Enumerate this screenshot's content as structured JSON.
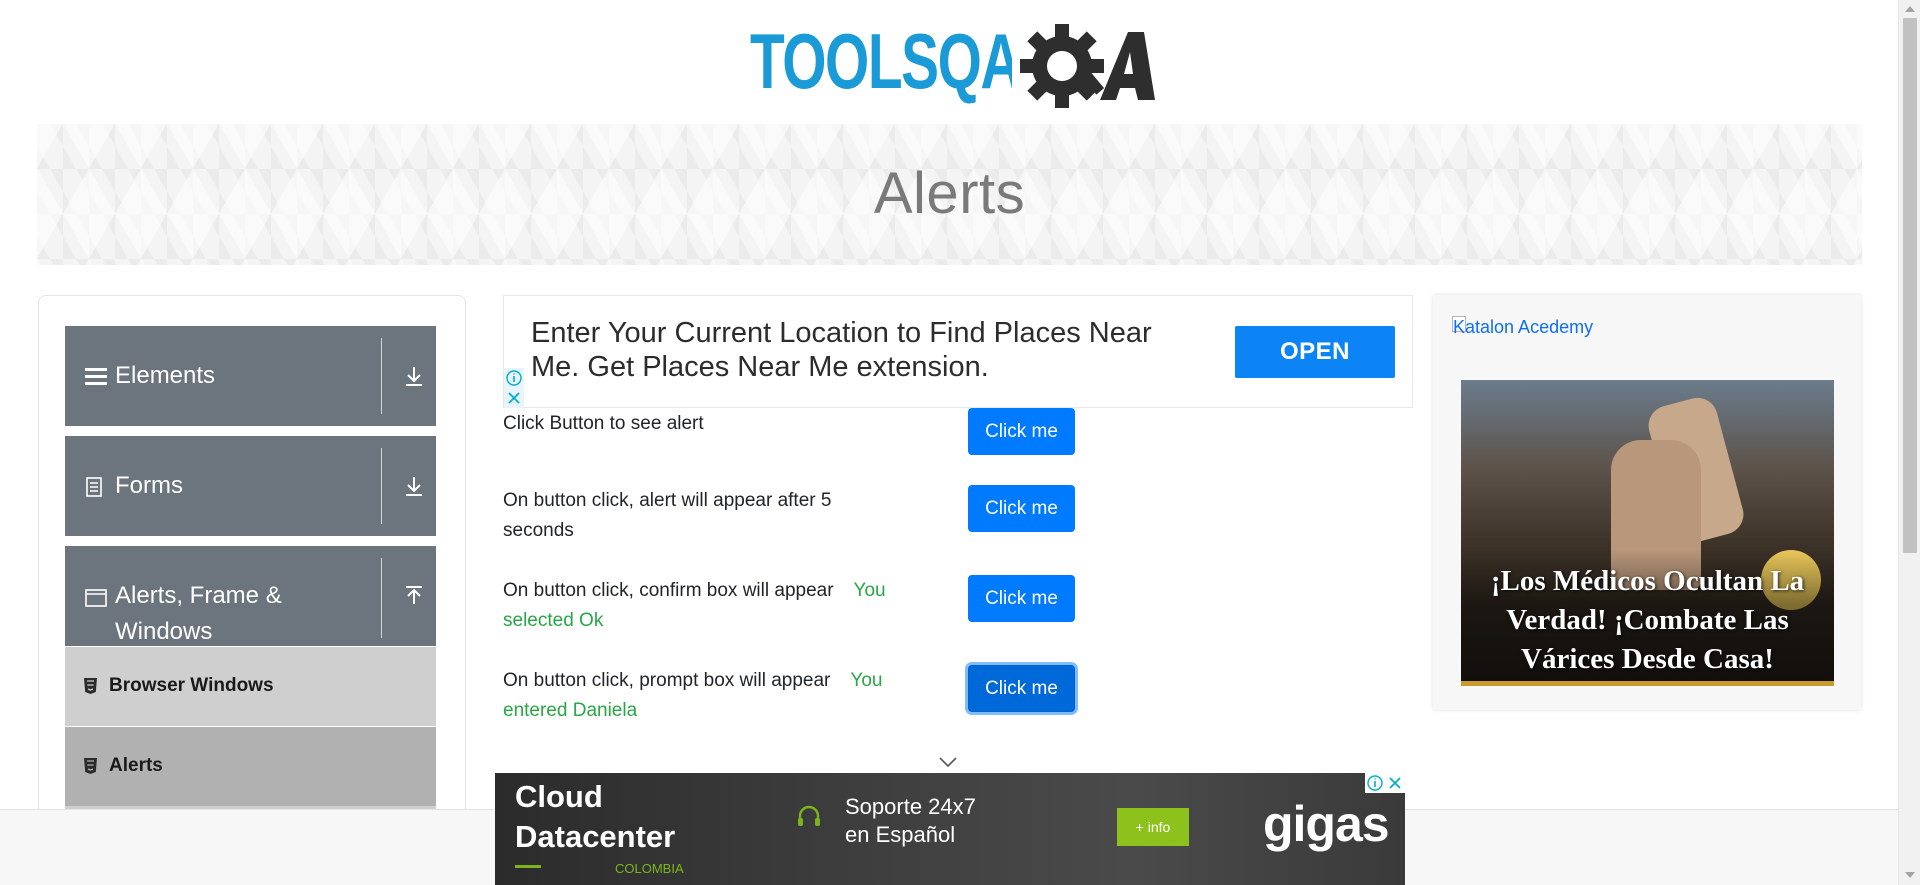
{
  "header": {
    "logo_text": "TOOLSQA",
    "colors": {
      "logo_blue": "#1a9bd7",
      "logo_dark": "#2e2e2e"
    }
  },
  "banner": {
    "title": "Alerts"
  },
  "sidebar": {
    "groups": [
      {
        "label": "Elements",
        "icon": "hamburger-icon",
        "arrow": "download-arrow-icon"
      },
      {
        "label": "Forms",
        "icon": "form-document-icon",
        "arrow": "download-arrow-icon"
      },
      {
        "label": "Alerts, Frame & Windows",
        "label_line1": "Alerts, Frame &",
        "label_line2": "Windows",
        "icon": "window-icon",
        "arrow": "upload-arrow-icon"
      }
    ],
    "items": [
      {
        "label": "Browser Windows",
        "icon": "html5-icon",
        "active": false
      },
      {
        "label": "Alerts",
        "icon": "html5-icon",
        "active": true
      }
    ],
    "colors": {
      "group_bg": "#6c757d",
      "item_bg": "#cfcfcf",
      "item_active_bg": "#b1b1b1"
    }
  },
  "ad_top": {
    "text": "Enter Your Current Location to Find Places Near Me. Get Places Near Me extension.",
    "button": "OPEN"
  },
  "alerts": [
    {
      "label": "Click Button to see alert",
      "result": "",
      "button": "Click me"
    },
    {
      "label": "On button click, alert will appear after 5 seconds",
      "label_line1": "On button click, alert will appear after 5",
      "label_line2": "seconds",
      "result": "",
      "button": "Click me"
    },
    {
      "label": "On button click, confirm box will appear",
      "result": "You selected Ok",
      "result_line1": "You",
      "result_line2": "selected Ok",
      "button": "Click me"
    },
    {
      "label": "On button click, prompt box will appear",
      "result": "You entered Daniela",
      "result_line1": "You",
      "result_line2": "entered Daniela",
      "button": "Click me"
    }
  ],
  "right_ad": {
    "image_alt": "Katalon Acedemy",
    "caption": "¡Los Médicos Ocultan La Verdad! ¡Combate Las Várices Desde Casa!"
  },
  "bottom_ad": {
    "title_line1": "Cloud",
    "title_line2": "Datacenter",
    "country": "COLOMBIA",
    "support_line1": "Soporte 24x7",
    "support_line2": "en Español",
    "button": "+ info",
    "brand": "gigas"
  },
  "colors": {
    "primary": "#007bff",
    "success": "#28a745",
    "link": "#0d6efd"
  }
}
